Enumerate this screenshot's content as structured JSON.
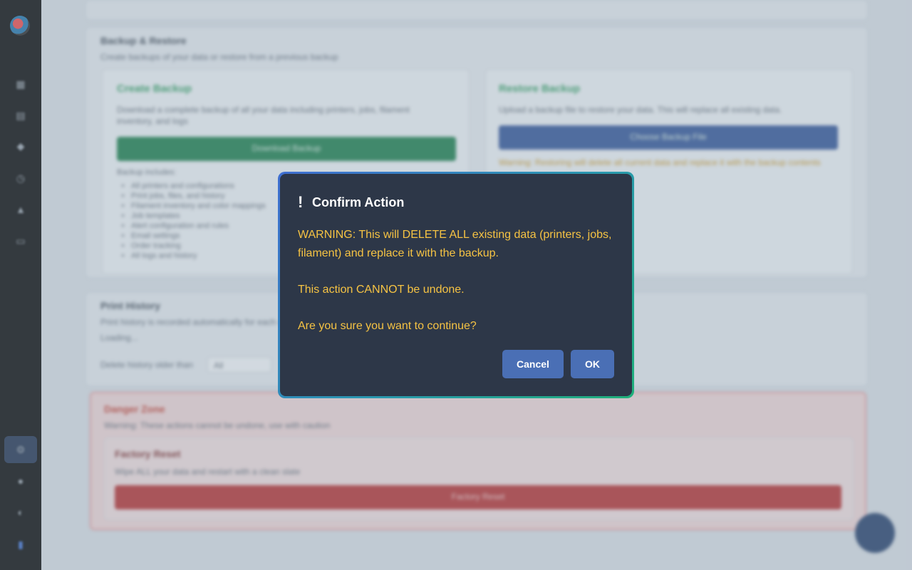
{
  "dialog": {
    "icon": "exclamation-icon",
    "title": "Confirm Action",
    "warning": "WARNING: This will DELETE ALL existing data (printers, jobs, filament) and replace it with the backup.",
    "undone": "This action CANNOT be undone.",
    "question": "Are you sure you want to continue?",
    "cancel_label": "Cancel",
    "ok_label": "OK"
  },
  "background": {
    "backup_section": {
      "title": "Backup & Restore",
      "description": "Create backups of your data or restore from a previous backup",
      "create": {
        "title": "Create Backup",
        "description": "Download a complete backup of all your data including printers, jobs, filament inventory, and logs",
        "button": "Download Backup",
        "includes_label": "Backup includes:",
        "items": [
          "All printers and configurations",
          "Print jobs, files, and history",
          "Filament inventory and color mappings",
          "Job templates",
          "Alert configuration and rules",
          "Email settings",
          "Order tracking",
          "All logs and history"
        ]
      },
      "restore": {
        "title": "Restore Backup",
        "description": "Upload a backup file to restore your data. This will replace all existing data.",
        "button": "Choose Backup File",
        "note": "Warning: Restoring will delete all current data and replace it with the backup contents"
      }
    },
    "history_section": {
      "title": "Print History",
      "description": "Print history is recorded automatically for each completed job",
      "status": "Loading...",
      "field_label": "Delete history older than",
      "field_value": "All"
    },
    "danger_section": {
      "title": "Danger Zone",
      "description": "Warning: These actions cannot be undone, use with caution",
      "reset_title": "Factory Reset",
      "reset_description": "Wipe ALL your data and restart with a clean slate",
      "reset_button": "Factory Reset"
    }
  },
  "colors": {
    "dialog_bg": "#2d3748",
    "message_text": "#f6c343",
    "button_bg": "#4a6fb5",
    "success": "#2b9a5c",
    "danger": "#c0392b"
  }
}
